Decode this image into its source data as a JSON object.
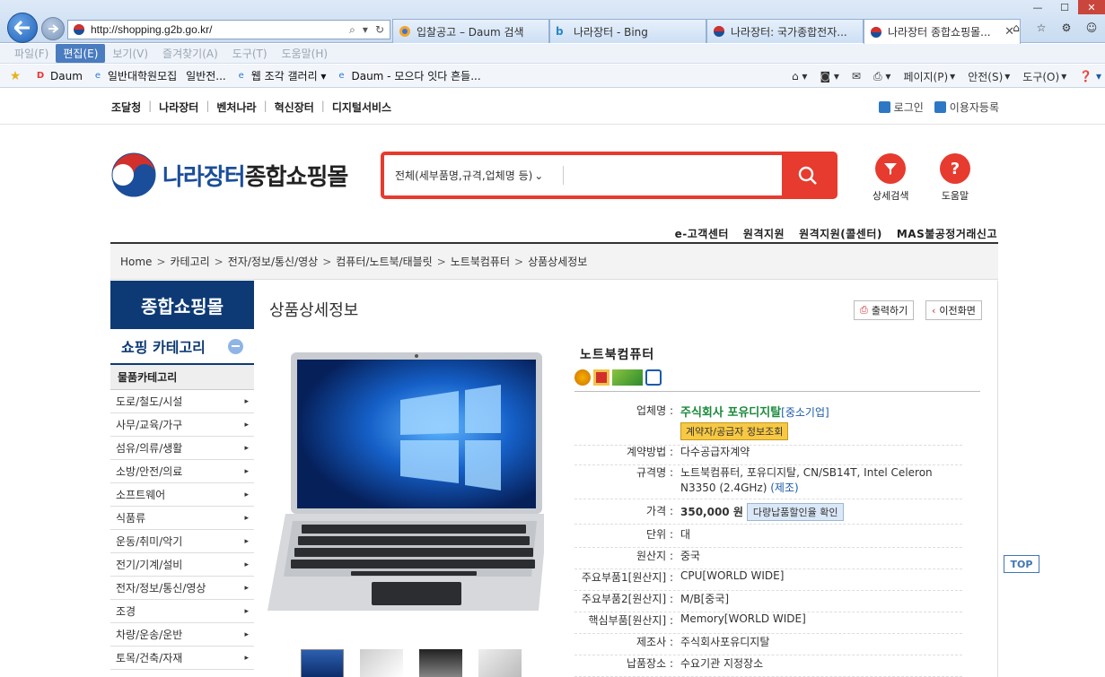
{
  "browser": {
    "url": "http://shopping.g2b.go.kr/",
    "tabs": [
      {
        "label": "입찰공고 – Daum 검색"
      },
      {
        "label": "나라장터 - Bing"
      },
      {
        "label": "나라장터: 국가종합전자..."
      },
      {
        "label": "나라장터 종합쇼핑몰..."
      }
    ],
    "menu": [
      "파일(F)",
      "편집(E)",
      "보기(V)",
      "즐겨찾기(A)",
      "도구(T)",
      "도움말(H)"
    ],
    "favorites": [
      "Daum",
      "일반대학원모집",
      "일반전...",
      "웹 조각 갤러리 ▾",
      "Daum - 모으다 잇다 흔들..."
    ],
    "commands": [
      "페이지(P)",
      "안전(S)",
      "도구(O)"
    ]
  },
  "site": {
    "util_links": [
      "조달청",
      "나라장터",
      "벤처나라",
      "혁신장터",
      "디지털서비스"
    ],
    "login": "로그인",
    "register": "이용자등록",
    "logo_a": "나라장터",
    "logo_b": "종합쇼핑몰",
    "search_select": "전체(세부품명,규격,업체명 등)",
    "search_value": "",
    "detail_search": "상세검색",
    "help": "도움말",
    "service_links": [
      "e-고객센터",
      "원격지원",
      "원격지원(콜센터)",
      "MAS불공정거래신고"
    ],
    "breadcrumb": [
      "Home",
      "카테고리",
      "전자/정보/통신/영상",
      "컴퓨터/노트북/태블릿",
      "노트북컴퓨터",
      "상품상세정보"
    ]
  },
  "sidebar": {
    "title": "종합쇼핑몰",
    "category_header": "쇼핑 카테고리",
    "sub_header": "물품카테고리",
    "items": [
      "도로/철도/시설",
      "사무/교육/가구",
      "섬유/의류/생활",
      "소방/안전/의료",
      "소프트웨어",
      "식품류",
      "운동/취미/악기",
      "전기/기계/설비",
      "전자/정보/통신/영상",
      "조경",
      "차량/운송/운반",
      "토목/건축/자재"
    ]
  },
  "main": {
    "title": "상품상세정보",
    "print_btn": "출력하기",
    "prev_btn": "이전화면",
    "product_name": "노트북컴퓨터",
    "top_link": "TOP",
    "info": {
      "vendor_label": "업체명 :",
      "vendor": "주식회사 포유디지탈",
      "vendor_tag": "[중소기업]",
      "vendor_btn": "계약자/공급자 정보조회",
      "contract_label": "계약방법 :",
      "contract": "다수공급자계약",
      "spec_label": "규격명 :",
      "spec": "노트북컴퓨터, 포유디지탈, CN/SB14T, Intel Celeron N3350 (2.4GHz)",
      "spec_link": "(제조)",
      "price_label": "가격 :",
      "price": "350,000 원",
      "price_btn": "다량납품할인율 확인",
      "unit_label": "단위 :",
      "unit": "대",
      "origin_label": "원산지 :",
      "origin": "중국",
      "part1_label": "주요부품1[원산지] :",
      "part1": "CPU[WORLD WIDE]",
      "part2_label": "주요부품2[원산지] :",
      "part2": "M/B[중국]",
      "core_label": "핵심부품[원산지] :",
      "core": "Memory[WORLD WIDE]",
      "maker_label": "제조사 :",
      "maker": "주식회사포유디지탈",
      "delivery_label": "납품장소 :",
      "delivery": "수요기관 지정장소"
    }
  }
}
